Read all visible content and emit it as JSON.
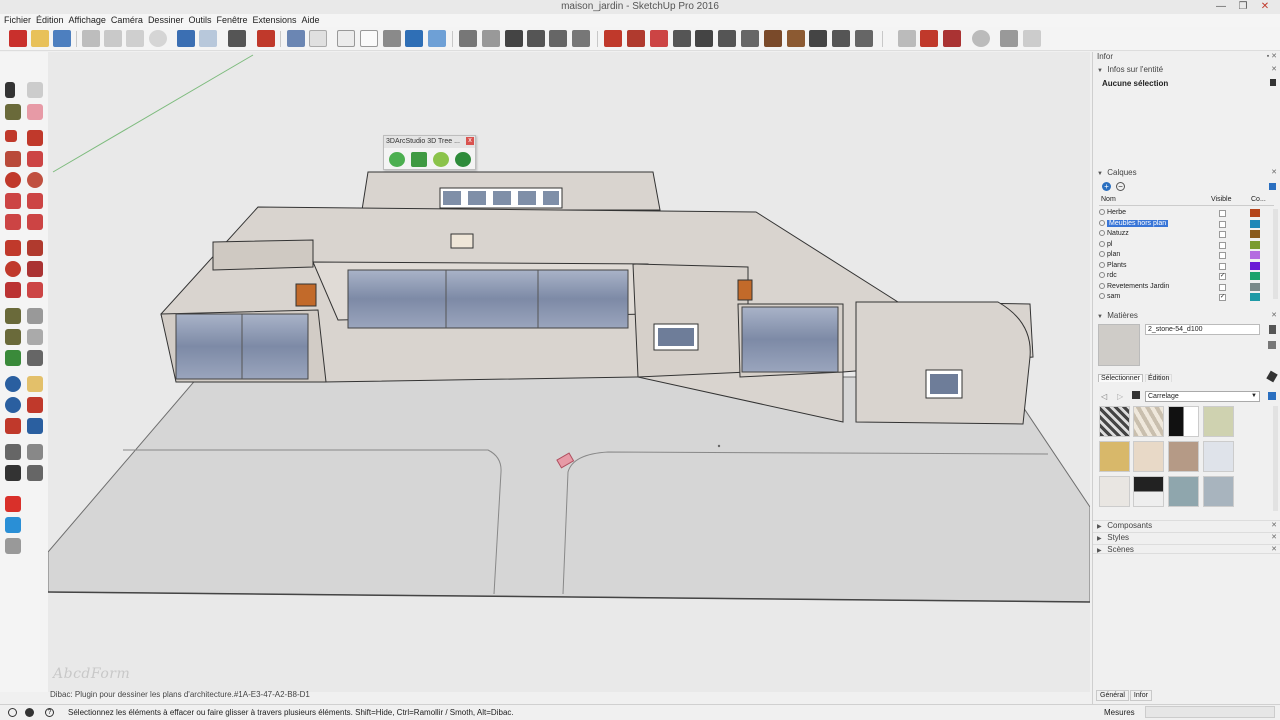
{
  "window": {
    "title": "maison_jardin - SketchUp Pro 2016",
    "buttons": [
      "—",
      "❐",
      "✕"
    ]
  },
  "menu": [
    "Fichier",
    "Édition",
    "Affichage",
    "Caméra",
    "Dessiner",
    "Outils",
    "Fenêtre",
    "Extensions",
    "Aide"
  ],
  "plugin_window": {
    "title": "3DArcStudio 3D Tree ...",
    "close": "x"
  },
  "viewport": {
    "watermark": "AbcdForm",
    "hint": "Dibac: Plugin pour dessiner les plans d'architecture.#1A-E3-47-A2-B8-D1"
  },
  "right_panel": {
    "tray_title": "Infor",
    "entity_info": {
      "header": "Infos sur l'entité",
      "value": "Aucune sélection"
    },
    "layers": {
      "header": "Calques",
      "columns": {
        "name": "Nom",
        "visible": "Visible",
        "color": "Co..."
      },
      "rows": [
        {
          "name": "Herbe",
          "visible": false,
          "color": "#b5451b"
        },
        {
          "name": "Meubles hors plan",
          "visible": false,
          "color": "#1e88b8",
          "selected": true
        },
        {
          "name": "Natuzz",
          "visible": false,
          "color": "#8a5a1c"
        },
        {
          "name": "pl",
          "visible": false,
          "color": "#7a9c2f"
        },
        {
          "name": "plan",
          "visible": false,
          "color": "#b46be0"
        },
        {
          "name": "Plants",
          "visible": false,
          "color": "#6a1bd6"
        },
        {
          "name": "rdc",
          "visible": true,
          "color": "#1aa36b"
        },
        {
          "name": "Revetements Jardin",
          "visible": false,
          "color": "#7a8a8a"
        },
        {
          "name": "sam",
          "visible": true,
          "color": "#1e9aa6"
        }
      ]
    },
    "materials": {
      "header": "Matières",
      "current_name": "2_stone-54_d100",
      "tabs": [
        "Sélectionner",
        "Édition"
      ],
      "library": "Carrelage"
    },
    "collapsed": [
      "Composants",
      "Styles",
      "Scènes"
    ],
    "bottom_tabs": [
      "Général",
      "Infor"
    ]
  },
  "status": {
    "message": "Sélectionnez les éléments à effacer ou faire glisser à travers plusieurs éléments. Shift=Hide, Ctrl=Ramollir / Smoth, Alt=Dibac.",
    "measure_label": "Mesures"
  },
  "colors": {
    "accent": "#3875d7",
    "wall": "#d9d4cf",
    "ground": "#d8d8d8",
    "glass": "#8a97b0"
  }
}
